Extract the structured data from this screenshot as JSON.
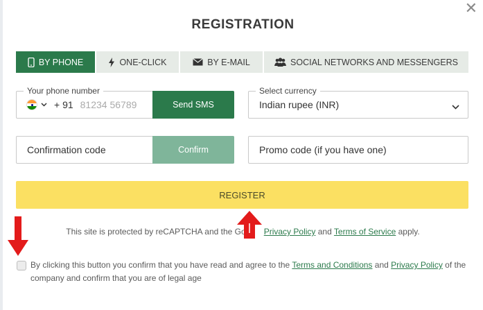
{
  "modal": {
    "title": "REGISTRATION",
    "close_glyph": "✕"
  },
  "tabs": [
    {
      "label": "BY PHONE",
      "icon": "phone-icon",
      "active": true
    },
    {
      "label": "ONE-CLICK",
      "icon": "lightning-icon",
      "active": false
    },
    {
      "label": "BY E-MAIL",
      "icon": "envelope-icon",
      "active": false
    },
    {
      "label": "SOCIAL NETWORKS AND MESSENGERS",
      "icon": "people-icon",
      "active": false
    }
  ],
  "phone": {
    "legend": "Your phone number",
    "country_code": "+ 91",
    "placeholder": "81234 56789",
    "send_label": "Send SMS"
  },
  "currency": {
    "legend": "Select currency",
    "value": "Indian rupee (INR)"
  },
  "confirmation": {
    "placeholder": "Confirmation code",
    "confirm_label": "Confirm"
  },
  "promo": {
    "placeholder": "Promo code (if you have one)"
  },
  "register_label": "REGISTER",
  "recaptcha": {
    "prefix": "This site is protected by reCAPTCHA and the Goo",
    "suffix_hidden": "gle",
    "privacy": "Privacy Policy",
    "and": "and",
    "terms": "Terms of Service",
    "apply": "apply."
  },
  "agreement": {
    "text_before": "By clicking this button you confirm that you have read and agree to the",
    "terms_link": "Terms and Conditions",
    "and": "and",
    "privacy_link": "Privacy Policy",
    "text_after": "of the company and confirm that you are of legal age"
  },
  "colors": {
    "accent_green": "#2b7a4b",
    "confirm_green": "#7fb59a",
    "register_yellow": "#fbe062",
    "annotation_red": "#e31b1b"
  }
}
